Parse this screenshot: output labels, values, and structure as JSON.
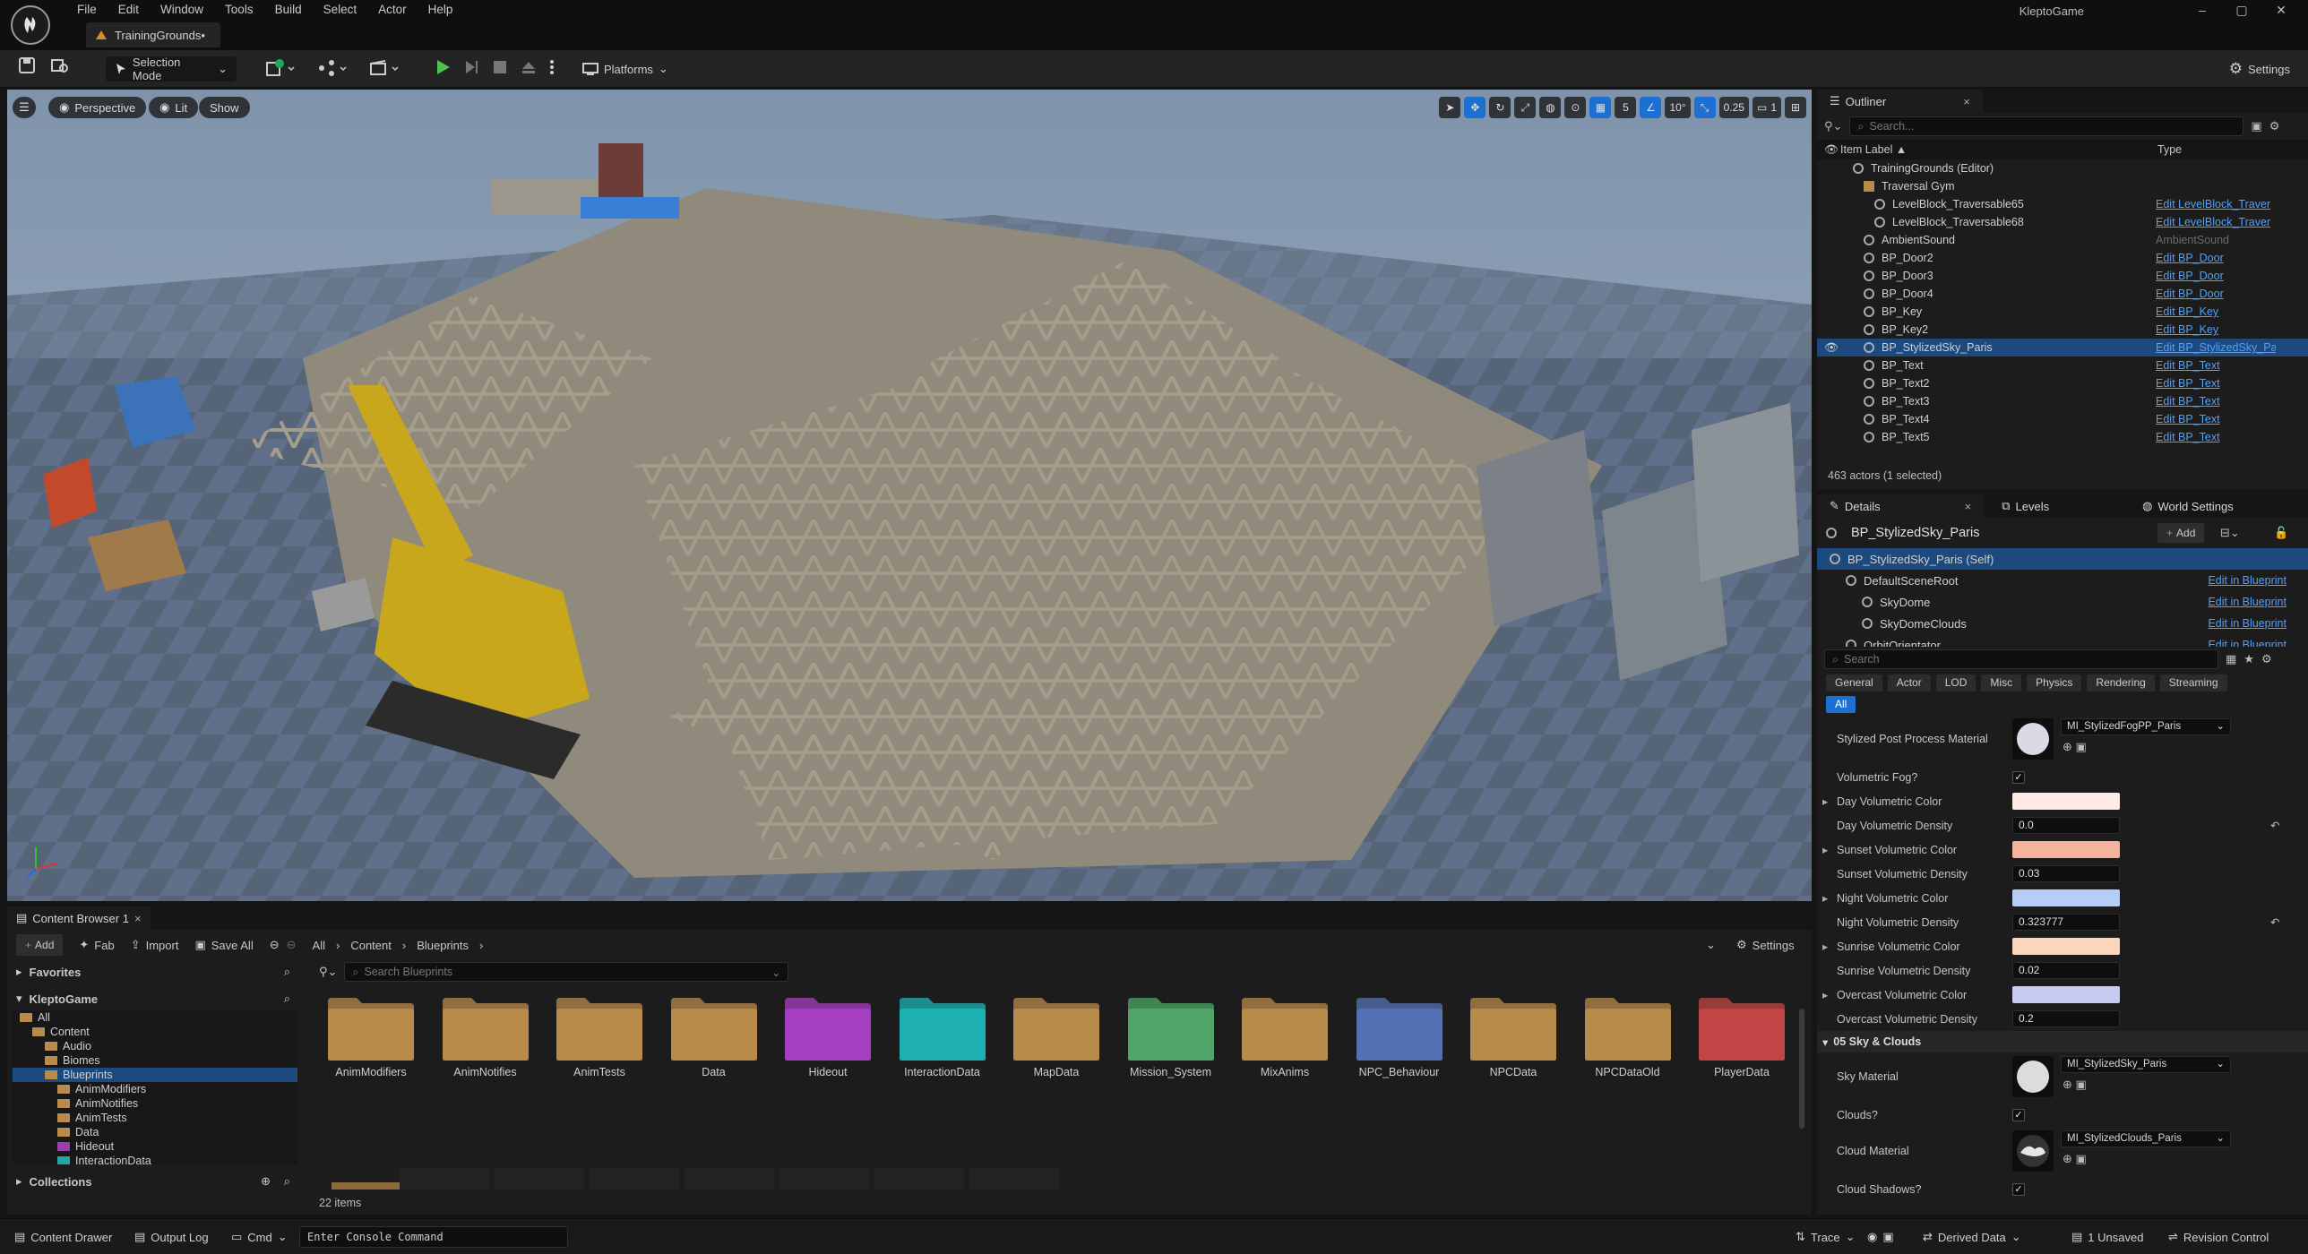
{
  "window": {
    "project": "KleptoGame",
    "tab": "TrainingGrounds•",
    "controls": [
      "–",
      "▢",
      "✕"
    ]
  },
  "menu": [
    "File",
    "Edit",
    "Window",
    "Tools",
    "Build",
    "Select",
    "Actor",
    "Help"
  ],
  "toolbar": {
    "mode": "Selection Mode",
    "platforms": "Platforms",
    "settings": "Settings"
  },
  "viewport": {
    "perspective": "Perspective",
    "lit": "Lit",
    "show": "Show",
    "grid": "5",
    "angle": "10°",
    "scale": "0.25",
    "camera": "1"
  },
  "outliner": {
    "tab": "Outliner",
    "search_placeholder": "Search...",
    "col_label": "Item Label ▲",
    "col_type": "Type",
    "rows": [
      {
        "label": "TrainingGrounds (Editor)",
        "type": "",
        "indent": 1,
        "link": false,
        "sel": false
      },
      {
        "label": "Traversal Gym",
        "type": "",
        "indent": 2,
        "link": false,
        "sel": false,
        "folder": true
      },
      {
        "label": "LevelBlock_Traversable65",
        "type": "Edit LevelBlock_Traver",
        "indent": 3,
        "link": true,
        "sel": false
      },
      {
        "label": "LevelBlock_Traversable68",
        "type": "Edit LevelBlock_Traver",
        "indent": 3,
        "link": true,
        "sel": false
      },
      {
        "label": "AmbientSound",
        "type": "AmbientSound",
        "indent": 2,
        "link": false,
        "sel": false
      },
      {
        "label": "BP_Door2",
        "type": "Edit BP_Door",
        "indent": 2,
        "link": true,
        "sel": false
      },
      {
        "label": "BP_Door3",
        "type": "Edit BP_Door",
        "indent": 2,
        "link": true,
        "sel": false
      },
      {
        "label": "BP_Door4",
        "type": "Edit BP_Door",
        "indent": 2,
        "link": true,
        "sel": false
      },
      {
        "label": "BP_Key",
        "type": "Edit BP_Key",
        "indent": 2,
        "link": true,
        "sel": false
      },
      {
        "label": "BP_Key2",
        "type": "Edit BP_Key",
        "indent": 2,
        "link": true,
        "sel": false
      },
      {
        "label": "BP_StylizedSky_Paris",
        "type": "Edit BP_StylizedSky_Pa",
        "indent": 2,
        "link": true,
        "sel": true
      },
      {
        "label": "BP_Text",
        "type": "Edit BP_Text",
        "indent": 2,
        "link": true,
        "sel": false
      },
      {
        "label": "BP_Text2",
        "type": "Edit BP_Text",
        "indent": 2,
        "link": true,
        "sel": false
      },
      {
        "label": "BP_Text3",
        "type": "Edit BP_Text",
        "indent": 2,
        "link": true,
        "sel": false
      },
      {
        "label": "BP_Text4",
        "type": "Edit BP_Text",
        "indent": 2,
        "link": true,
        "sel": false
      },
      {
        "label": "BP_Text5",
        "type": "Edit BP_Text",
        "indent": 2,
        "link": true,
        "sel": false
      }
    ],
    "count": "463 actors (1 selected)"
  },
  "details": {
    "tabs": [
      "Details",
      "Levels",
      "World Settings"
    ],
    "actor": "BP_StylizedSky_Paris",
    "add": "Add",
    "components": [
      {
        "label": "BP_StylizedSky_Paris (Self)",
        "edit": "",
        "indent": 0,
        "sel": true
      },
      {
        "label": "DefaultSceneRoot",
        "edit": "Edit in Blueprint",
        "indent": 1,
        "sel": false
      },
      {
        "label": "SkyDome",
        "edit": "Edit in Blueprint",
        "indent": 2,
        "sel": false
      },
      {
        "label": "SkyDomeClouds",
        "edit": "Edit in Blueprint",
        "indent": 2,
        "sel": false
      },
      {
        "label": "OrbitOrientator",
        "edit": "Edit in Blueprint",
        "indent": 1,
        "sel": false
      }
    ],
    "search_placeholder": "Search",
    "filters": [
      "General",
      "Actor",
      "LOD",
      "Misc",
      "Physics",
      "Rendering",
      "Streaming"
    ],
    "filter_all": "All",
    "post_process": {
      "label": "Stylized Post Process Material",
      "value": "MI_StylizedFogPP_Paris"
    },
    "vol_fog": "Volumetric Fog?",
    "props": [
      {
        "label": "Day Volumetric Color",
        "kind": "color",
        "color": "#fde9e6",
        "exp": true
      },
      {
        "label": "Day Volumetric Density",
        "kind": "num",
        "value": "0.0",
        "reset": true
      },
      {
        "label": "Sunset Volumetric Color",
        "kind": "color",
        "color": "#f6b39c",
        "exp": true
      },
      {
        "label": "Sunset Volumetric Density",
        "kind": "num",
        "value": "0.03"
      },
      {
        "label": "Night Volumetric Color",
        "kind": "color",
        "color": "#b6cdf7",
        "exp": true
      },
      {
        "label": "Night Volumetric Density",
        "kind": "num",
        "value": "0.323777",
        "reset": true
      },
      {
        "label": "Sunrise Volumetric Color",
        "kind": "color",
        "color": "#fcd6ba",
        "exp": true
      },
      {
        "label": "Sunrise Volumetric Density",
        "kind": "num",
        "value": "0.02"
      },
      {
        "label": "Overcast Volumetric Color",
        "kind": "color",
        "color": "#c6cbf0",
        "exp": true
      },
      {
        "label": "Overcast Volumetric Density",
        "kind": "num",
        "value": "0.2"
      }
    ],
    "section": "05 Sky & Clouds",
    "sky_material": {
      "label": "Sky Material",
      "value": "MI_StylizedSky_Paris"
    },
    "clouds": "Clouds?",
    "cloud_material": {
      "label": "Cloud Material",
      "value": "MI_StylizedClouds_Paris"
    },
    "cloud_shadows": "Cloud Shadows?"
  },
  "content_browser": {
    "tab": "Content Browser 1",
    "add": "Add",
    "fab": "Fab",
    "import": "Import",
    "save_all": "Save All",
    "path": [
      "All",
      "Content",
      "Blueprints"
    ],
    "settings": "Settings",
    "favorites": "Favorites",
    "project": "KleptoGame",
    "collections": "Collections",
    "search_placeholder": "Search Blueprints",
    "tree": [
      {
        "label": "All",
        "indent": 0,
        "color": "#b88a4b"
      },
      {
        "label": "Content",
        "indent": 1,
        "color": "#b88a4b"
      },
      {
        "label": "Audio",
        "indent": 2,
        "color": "#b88a4b"
      },
      {
        "label": "Biomes",
        "indent": 2,
        "color": "#b88a4b"
      },
      {
        "label": "Blueprints",
        "indent": 2,
        "color": "#b88a4b",
        "sel": true
      },
      {
        "label": "AnimModifiers",
        "indent": 3,
        "color": "#b88a4b"
      },
      {
        "label": "AnimNotifies",
        "indent": 3,
        "color": "#b88a4b"
      },
      {
        "label": "AnimTests",
        "indent": 3,
        "color": "#b88a4b"
      },
      {
        "label": "Data",
        "indent": 3,
        "color": "#b88a4b"
      },
      {
        "label": "Hideout",
        "indent": 3,
        "color": "#9a3fae"
      },
      {
        "label": "InteractionData",
        "indent": 3,
        "color": "#21a5a5"
      }
    ],
    "folders": [
      {
        "name": "AnimModifiers",
        "color": "#b88a4b"
      },
      {
        "name": "AnimNotifies",
        "color": "#b88a4b"
      },
      {
        "name": "AnimTests",
        "color": "#b88a4b"
      },
      {
        "name": "Data",
        "color": "#b88a4b"
      },
      {
        "name": "Hideout",
        "color": "#a53fbf"
      },
      {
        "name": "InteractionData",
        "color": "#1fb1b1"
      },
      {
        "name": "MapData",
        "color": "#b88a4b"
      },
      {
        "name": "Mission_System",
        "color": "#4fa56a"
      },
      {
        "name": "MixAnims",
        "color": "#b88a4b"
      },
      {
        "name": "NPC_Behaviour",
        "color": "#5371b3"
      },
      {
        "name": "NPCData",
        "color": "#b88a4b"
      },
      {
        "name": "NPCDataOld",
        "color": "#b88a4b"
      },
      {
        "name": "PlayerData",
        "color": "#c24545"
      }
    ],
    "count": "22 items"
  },
  "statusbar": {
    "drawer": "Content Drawer",
    "output": "Output Log",
    "cmd": "Cmd",
    "console_placeholder": "Enter Console Command",
    "trace": "Trace",
    "derived": "Derived Data",
    "unsaved": "1 Unsaved",
    "revision": "Revision Control"
  }
}
